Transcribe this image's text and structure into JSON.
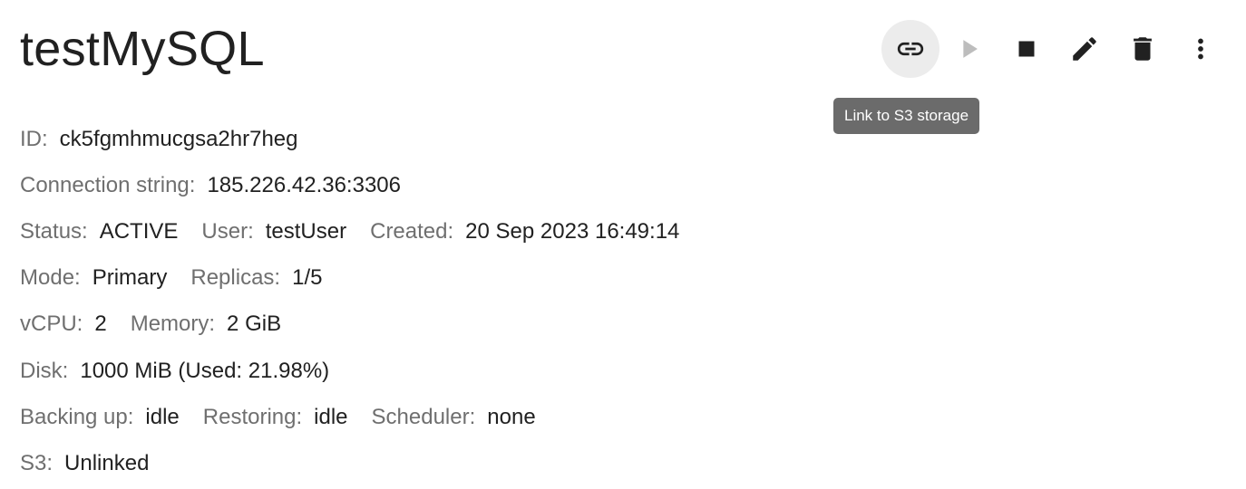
{
  "header": {
    "title": "testMySQL"
  },
  "toolbar": {
    "tooltip": "Link to S3 storage",
    "actions": [
      {
        "name": "link-icon",
        "state": "hover"
      },
      {
        "name": "play-icon",
        "state": "disabled"
      },
      {
        "name": "stop-icon",
        "state": "enabled"
      },
      {
        "name": "edit-icon",
        "state": "enabled"
      },
      {
        "name": "delete-icon",
        "state": "enabled"
      },
      {
        "name": "more-vert-icon",
        "state": "enabled"
      }
    ]
  },
  "details": {
    "id": {
      "label": "ID:",
      "value": "ck5fgmhmucgsa2hr7heg"
    },
    "connection": {
      "label": "Connection string:",
      "value": "185.226.42.36:3306"
    },
    "status": {
      "label": "Status:",
      "value": "ACTIVE"
    },
    "user": {
      "label": "User:",
      "value": "testUser"
    },
    "created": {
      "label": "Created:",
      "value": "20 Sep 2023 16:49:14"
    },
    "mode": {
      "label": "Mode:",
      "value": "Primary"
    },
    "replicas": {
      "label": "Replicas:",
      "value": "1/5"
    },
    "vcpu": {
      "label": "vCPU:",
      "value": "2"
    },
    "memory": {
      "label": "Memory:",
      "value": "2 GiB"
    },
    "disk": {
      "label": "Disk:",
      "value": "1000 MiB (Used: 21.98%)"
    },
    "backing_up": {
      "label": "Backing up:",
      "value": "idle"
    },
    "restoring": {
      "label": "Restoring:",
      "value": "idle"
    },
    "scheduler": {
      "label": "Scheduler:",
      "value": "none"
    },
    "s3": {
      "label": "S3:",
      "value": "Unlinked"
    }
  },
  "colors": {
    "label": "#6f6f6f",
    "value": "#212121",
    "tooltip_bg": "#6b6b6b",
    "icon": "#212121",
    "icon_disabled": "#bdbdbd"
  }
}
